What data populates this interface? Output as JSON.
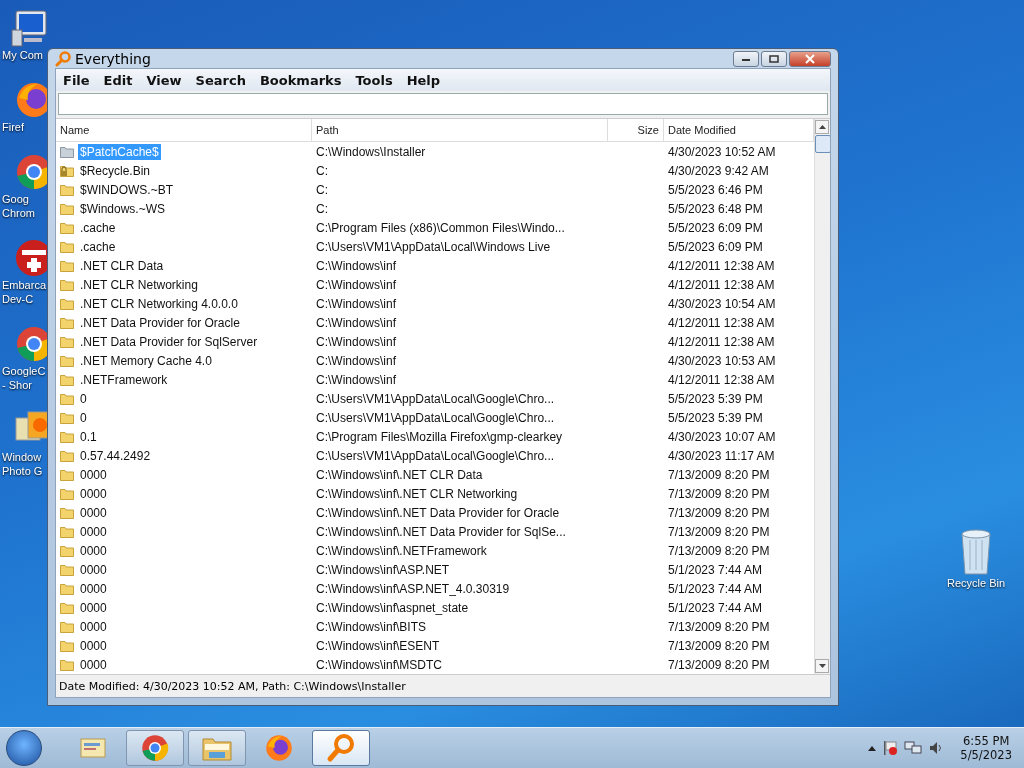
{
  "desktop_icons": [
    {
      "kind": "computer",
      "lines": [
        "My Com"
      ]
    },
    {
      "kind": "firefox",
      "lines": [
        "Firef"
      ]
    },
    {
      "kind": "chrome",
      "lines": [
        "Goog",
        "Chrom"
      ]
    },
    {
      "kind": "devcpp",
      "lines": [
        "Embarca",
        "Dev-C"
      ]
    },
    {
      "kind": "chrome",
      "lines": [
        "GoogleC",
        "- Shor"
      ]
    },
    {
      "kind": "photo",
      "lines": [
        "Window",
        "Photo G"
      ]
    }
  ],
  "recycle_bin": {
    "label": "Recycle Bin"
  },
  "window": {
    "title": "Everything"
  },
  "menu": [
    "File",
    "Edit",
    "View",
    "Search",
    "Bookmarks",
    "Tools",
    "Help"
  ],
  "table": {
    "columns": [
      "Name",
      "Path",
      "Size",
      "Date Modified"
    ],
    "rows": [
      {
        "kind": "plain",
        "selected": true,
        "name": "$PatchCache$",
        "path": "C:\\Windows\\Installer",
        "date": "4/30/2023 10:52 AM"
      },
      {
        "kind": "locked",
        "selected": false,
        "name": "$Recycle.Bin",
        "path": "C:",
        "date": "4/30/2023 9:42 AM"
      },
      {
        "kind": "folder",
        "selected": false,
        "name": "$WINDOWS.~BT",
        "path": "C:",
        "date": "5/5/2023 6:46 PM"
      },
      {
        "kind": "folder",
        "selected": false,
        "name": "$Windows.~WS",
        "path": "C:",
        "date": "5/5/2023 6:48 PM"
      },
      {
        "kind": "folder",
        "selected": false,
        "name": ".cache",
        "path": "C:\\Program Files (x86)\\Common Files\\Windo...",
        "date": "5/5/2023 6:09 PM"
      },
      {
        "kind": "folder",
        "selected": false,
        "name": ".cache",
        "path": "C:\\Users\\VM1\\AppData\\Local\\Windows Live",
        "date": "5/5/2023 6:09 PM"
      },
      {
        "kind": "folder",
        "selected": false,
        "name": ".NET CLR Data",
        "path": "C:\\Windows\\inf",
        "date": "4/12/2011 12:38 AM"
      },
      {
        "kind": "folder",
        "selected": false,
        "name": ".NET CLR Networking",
        "path": "C:\\Windows\\inf",
        "date": "4/12/2011 12:38 AM"
      },
      {
        "kind": "folder",
        "selected": false,
        "name": ".NET CLR Networking 4.0.0.0",
        "path": "C:\\Windows\\inf",
        "date": "4/30/2023 10:54 AM"
      },
      {
        "kind": "folder",
        "selected": false,
        "name": ".NET Data Provider for Oracle",
        "path": "C:\\Windows\\inf",
        "date": "4/12/2011 12:38 AM"
      },
      {
        "kind": "folder",
        "selected": false,
        "name": ".NET Data Provider for SqlServer",
        "path": "C:\\Windows\\inf",
        "date": "4/12/2011 12:38 AM"
      },
      {
        "kind": "folder",
        "selected": false,
        "name": ".NET Memory Cache 4.0",
        "path": "C:\\Windows\\inf",
        "date": "4/30/2023 10:53 AM"
      },
      {
        "kind": "folder",
        "selected": false,
        "name": ".NETFramework",
        "path": "C:\\Windows\\inf",
        "date": "4/12/2011 12:38 AM"
      },
      {
        "kind": "folder",
        "selected": false,
        "name": "0",
        "path": "C:\\Users\\VM1\\AppData\\Local\\Google\\Chro...",
        "date": "5/5/2023 5:39 PM"
      },
      {
        "kind": "folder",
        "selected": false,
        "name": "0",
        "path": "C:\\Users\\VM1\\AppData\\Local\\Google\\Chro...",
        "date": "5/5/2023 5:39 PM"
      },
      {
        "kind": "folder",
        "selected": false,
        "name": "0.1",
        "path": "C:\\Program Files\\Mozilla Firefox\\gmp-clearkey",
        "date": "4/30/2023 10:07 AM"
      },
      {
        "kind": "folder",
        "selected": false,
        "name": "0.57.44.2492",
        "path": "C:\\Users\\VM1\\AppData\\Local\\Google\\Chro...",
        "date": "4/30/2023 11:17 AM"
      },
      {
        "kind": "folder",
        "selected": false,
        "name": "0000",
        "path": "C:\\Windows\\inf\\.NET CLR Data",
        "date": "7/13/2009 8:20 PM"
      },
      {
        "kind": "folder",
        "selected": false,
        "name": "0000",
        "path": "C:\\Windows\\inf\\.NET CLR Networking",
        "date": "7/13/2009 8:20 PM"
      },
      {
        "kind": "folder",
        "selected": false,
        "name": "0000",
        "path": "C:\\Windows\\inf\\.NET Data Provider for Oracle",
        "date": "7/13/2009 8:20 PM"
      },
      {
        "kind": "folder",
        "selected": false,
        "name": "0000",
        "path": "C:\\Windows\\inf\\.NET Data Provider for SqlSe...",
        "date": "7/13/2009 8:20 PM"
      },
      {
        "kind": "folder",
        "selected": false,
        "name": "0000",
        "path": "C:\\Windows\\inf\\.NETFramework",
        "date": "7/13/2009 8:20 PM"
      },
      {
        "kind": "folder",
        "selected": false,
        "name": "0000",
        "path": "C:\\Windows\\inf\\ASP.NET",
        "date": "5/1/2023 7:44 AM"
      },
      {
        "kind": "folder",
        "selected": false,
        "name": "0000",
        "path": "C:\\Windows\\inf\\ASP.NET_4.0.30319",
        "date": "5/1/2023 7:44 AM"
      },
      {
        "kind": "folder",
        "selected": false,
        "name": "0000",
        "path": "C:\\Windows\\inf\\aspnet_state",
        "date": "5/1/2023 7:44 AM"
      },
      {
        "kind": "folder",
        "selected": false,
        "name": "0000",
        "path": "C:\\Windows\\inf\\BITS",
        "date": "7/13/2009 8:20 PM"
      },
      {
        "kind": "folder",
        "selected": false,
        "name": "0000",
        "path": "C:\\Windows\\inf\\ESENT",
        "date": "7/13/2009 8:20 PM"
      },
      {
        "kind": "folder",
        "selected": false,
        "name": "0000",
        "path": "C:\\Windows\\inf\\MSDTC",
        "date": "7/13/2009 8:20 PM"
      }
    ]
  },
  "status_bar": "Date Modified: 4/30/2023 10:52 AM, Path: C:\\Windows\\Installer",
  "taskbar": {
    "items": [
      {
        "kind": "mail",
        "running": false,
        "selected": false
      },
      {
        "kind": "chrome",
        "running": true,
        "selected": false
      },
      {
        "kind": "explorer",
        "running": true,
        "selected": false
      },
      {
        "kind": "firefox",
        "running": false,
        "selected": false
      },
      {
        "kind": "search",
        "running": true,
        "selected": true
      }
    ],
    "clock": {
      "time": "6:55 PM",
      "date": "5/5/2023"
    }
  }
}
